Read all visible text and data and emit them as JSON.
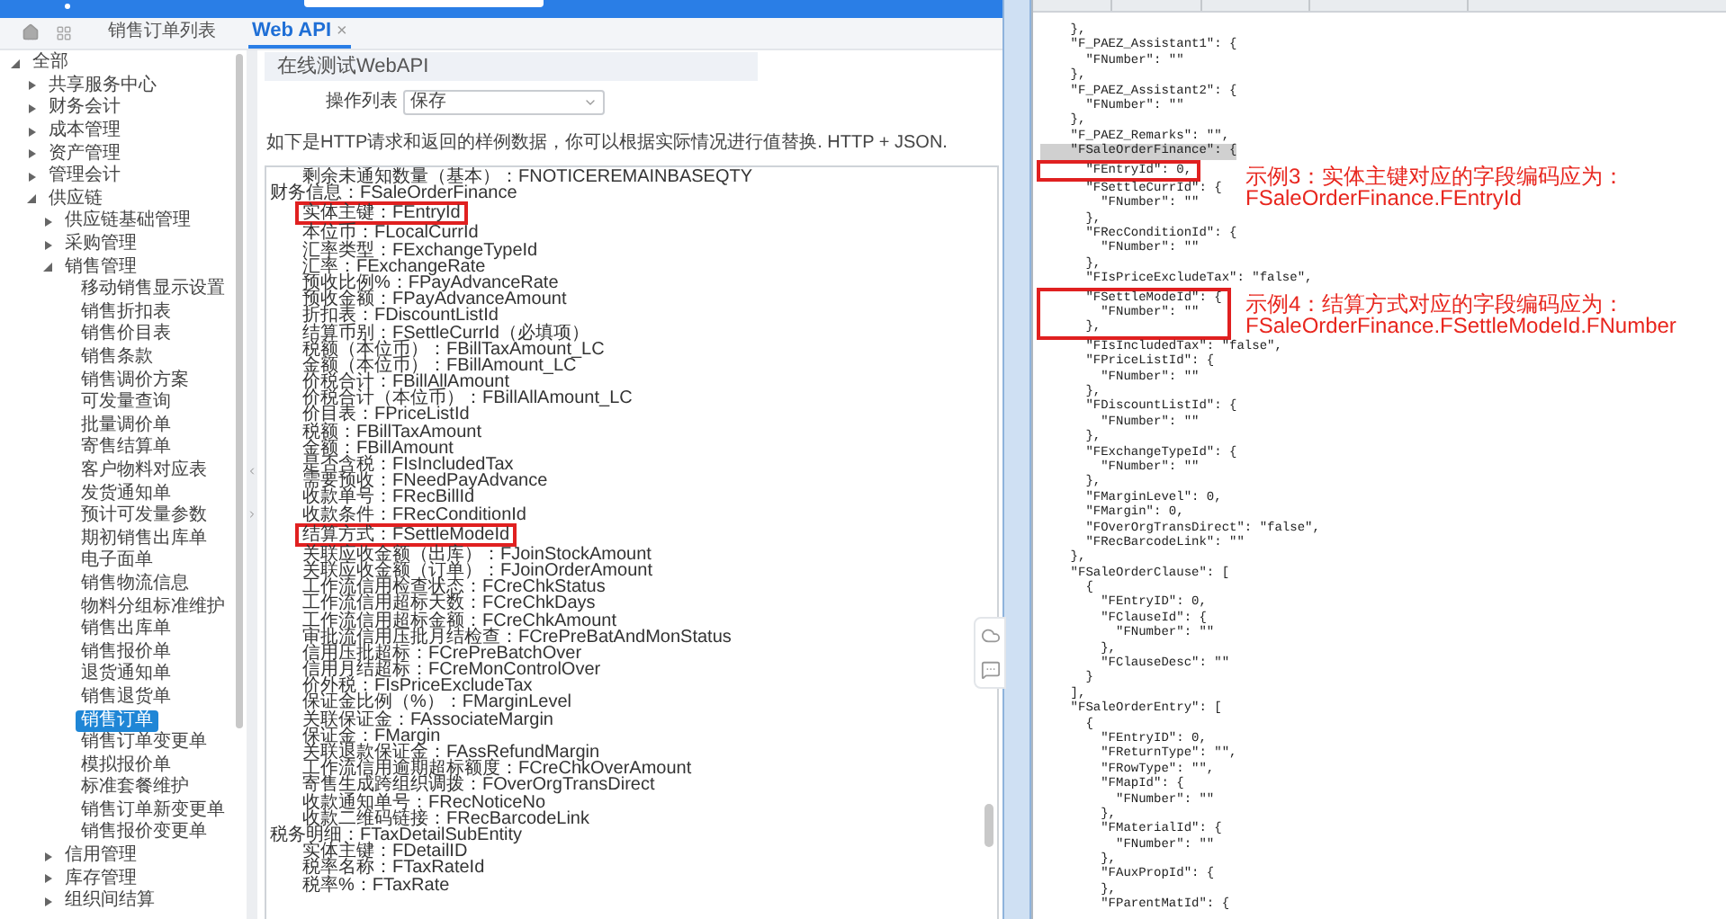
{
  "tabs": [
    {
      "label": "销售订单列表",
      "selected": false
    },
    {
      "label": "Web API",
      "selected": true,
      "close_glyph": "×"
    }
  ],
  "tree": [
    {
      "label": "全部",
      "selected": false,
      "expanded": true,
      "children": [
        {
          "label": "共享服务中心",
          "selected": false,
          "expanded": false
        },
        {
          "label": "财务会计",
          "selected": false,
          "expanded": false
        },
        {
          "label": "成本管理",
          "selected": false,
          "expanded": false
        },
        {
          "label": "资产管理",
          "selected": false,
          "expanded": false
        },
        {
          "label": "管理会计",
          "selected": false,
          "expanded": false
        },
        {
          "label": "供应链",
          "selected": false,
          "expanded": true,
          "children": [
            {
              "label": "供应链基础管理",
              "selected": false,
              "expanded": false
            },
            {
              "label": "采购管理",
              "selected": false,
              "expanded": false
            },
            {
              "label": "销售管理",
              "selected": false,
              "expanded": true,
              "children": [
                {
                  "label": "移动销售显示设置",
                  "selected": false
                },
                {
                  "label": "销售折扣表",
                  "selected": false
                },
                {
                  "label": "销售价目表",
                  "selected": false
                },
                {
                  "label": "销售条款",
                  "selected": false
                },
                {
                  "label": "销售调价方案",
                  "selected": false
                },
                {
                  "label": "可发量查询",
                  "selected": false
                },
                {
                  "label": "批量调价单",
                  "selected": false
                },
                {
                  "label": "寄售结算单",
                  "selected": false
                },
                {
                  "label": "客户物料对应表",
                  "selected": false
                },
                {
                  "label": "发货通知单",
                  "selected": false
                },
                {
                  "label": "预计可发量参数",
                  "selected": false
                },
                {
                  "label": "期初销售出库单",
                  "selected": false
                },
                {
                  "label": "电子面单",
                  "selected": false
                },
                {
                  "label": "销售物流信息",
                  "selected": false
                },
                {
                  "label": "物料分组标准维护",
                  "selected": false
                },
                {
                  "label": "销售出库单",
                  "selected": false
                },
                {
                  "label": "销售报价单",
                  "selected": false
                },
                {
                  "label": "退货通知单",
                  "selected": false
                },
                {
                  "label": "销售退货单",
                  "selected": false
                },
                {
                  "label": "销售订单",
                  "selected": true
                },
                {
                  "label": "销售订单变更单",
                  "selected": false
                },
                {
                  "label": "模拟报价单",
                  "selected": false
                },
                {
                  "label": "标准套餐维护",
                  "selected": false
                },
                {
                  "label": "销售订单新变更单",
                  "selected": false
                },
                {
                  "label": "销售报价变更单",
                  "selected": false
                }
              ]
            },
            {
              "label": "信用管理",
              "selected": false,
              "expanded": false
            },
            {
              "label": "库存管理",
              "selected": false,
              "expanded": false
            },
            {
              "label": "组织间结算",
              "selected": false,
              "expanded": false
            }
          ]
        }
      ]
    }
  ],
  "panel": {
    "title": "在线测试WebAPI",
    "operation_label": "操作列表",
    "operation_value": "保存",
    "description": "如下是HTTP请求和返回的样例数据，你可以根据实际情况进行值替换. HTTP + JSON."
  },
  "field_list": [
    {
      "kind": "field",
      "text": "剩余未通知数量（基本）：FNOTICEREMAINBASEQTY",
      "boxed": false
    },
    {
      "kind": "section",
      "text": "财务信息：FSaleOrderFinance",
      "boxed": false,
      "children": [
        {
          "kind": "field",
          "text": "实体主键：FEntryId",
          "boxed": true
        },
        {
          "kind": "field",
          "text": "本位币：FLocalCurrId",
          "boxed": false
        },
        {
          "kind": "field",
          "text": "汇率类型：FExchangeTypeId",
          "boxed": false
        },
        {
          "kind": "field",
          "text": "汇率：FExchangeRate",
          "boxed": false
        },
        {
          "kind": "field",
          "text": "预收比例%：FPayAdvanceRate",
          "boxed": false
        },
        {
          "kind": "field",
          "text": "预收金额：FPayAdvanceAmount",
          "boxed": false
        },
        {
          "kind": "field",
          "text": "折扣表：FDiscountListId",
          "boxed": false
        },
        {
          "kind": "field",
          "text": "结算币别：FSettleCurrId（必填项）",
          "boxed": false
        },
        {
          "kind": "field",
          "text": "税额（本位币）：FBillTaxAmount_LC",
          "boxed": false
        },
        {
          "kind": "field",
          "text": "金额（本位币）：FBillAmount_LC",
          "boxed": false
        },
        {
          "kind": "field",
          "text": "价税合计：FBillAllAmount",
          "boxed": false
        },
        {
          "kind": "field",
          "text": "价税合计（本位币）：FBillAllAmount_LC",
          "boxed": false
        },
        {
          "kind": "field",
          "text": "价目表：FPriceListId",
          "boxed": false
        },
        {
          "kind": "field",
          "text": "税额：FBillTaxAmount",
          "boxed": false
        },
        {
          "kind": "field",
          "text": "金额：FBillAmount",
          "boxed": false
        },
        {
          "kind": "field",
          "text": "是否含税：FIsIncludedTax",
          "boxed": false
        },
        {
          "kind": "field",
          "text": "需要预收：FNeedPayAdvance",
          "boxed": false
        },
        {
          "kind": "field",
          "text": "收款单号：FRecBillId",
          "boxed": false
        },
        {
          "kind": "field",
          "text": "收款条件：FRecConditionId",
          "boxed": false
        },
        {
          "kind": "field",
          "text": "结算方式：FSettleModeId",
          "boxed": true
        },
        {
          "kind": "field",
          "text": "关联应收金额（出库）：FJoinStockAmount",
          "boxed": false
        },
        {
          "kind": "field",
          "text": "关联应收金额（订单）：FJoinOrderAmount",
          "boxed": false
        },
        {
          "kind": "field",
          "text": "工作流信用检查状态：FCreChkStatus",
          "boxed": false
        },
        {
          "kind": "field",
          "text": "工作流信用超标天数：FCreChkDays",
          "boxed": false
        },
        {
          "kind": "field",
          "text": "工作流信用超标金额：FCreChkAmount",
          "boxed": false
        },
        {
          "kind": "field",
          "text": "审批流信用压批月结检查：FCrePreBatAndMonStatus",
          "boxed": false
        },
        {
          "kind": "field",
          "text": "信用压批超标：FCrePreBatchOver",
          "boxed": false
        },
        {
          "kind": "field",
          "text": "信用月结超标：FCreMonControlOver",
          "boxed": false
        },
        {
          "kind": "field",
          "text": "价外税：FIsPriceExcludeTax",
          "boxed": false
        },
        {
          "kind": "field",
          "text": "保证金比例（%）：FMarginLevel",
          "boxed": false
        },
        {
          "kind": "field",
          "text": "关联保证金：FAssociateMargin",
          "boxed": false
        },
        {
          "kind": "field",
          "text": "保证金：FMargin",
          "boxed": false
        },
        {
          "kind": "field",
          "text": "关联退款保证金：FAssRefundMargin",
          "boxed": false
        },
        {
          "kind": "field",
          "text": "工作流信用逾期超标额度：FCreChkOverAmount",
          "boxed": false
        },
        {
          "kind": "field",
          "text": "寄售生成跨组织调拨：FOverOrgTransDirect",
          "boxed": false
        },
        {
          "kind": "field",
          "text": "收款通知单号：FRecNoticeNo",
          "boxed": false
        },
        {
          "kind": "field",
          "text": "收款二维码链接：FRecBarcodeLink",
          "boxed": false
        }
      ]
    },
    {
      "kind": "section",
      "text": "税务明细：FTaxDetailSubEntity",
      "boxed": false,
      "children": [
        {
          "kind": "field",
          "text": "实体主键：FDetailID",
          "boxed": false
        },
        {
          "kind": "field",
          "text": "税率名称：FTaxRateId",
          "boxed": false
        },
        {
          "kind": "field",
          "text": "税率%：FTaxRate",
          "boxed": false
        }
      ]
    }
  ],
  "json_lines": [
    {
      "text": "    },",
      "boxed": false,
      "highlighted": false
    },
    {
      "text": "    \"F_PAEZ_Assistant1\": {",
      "boxed": false,
      "highlighted": false
    },
    {
      "text": "      \"FNumber\": \"\"",
      "boxed": false,
      "highlighted": false
    },
    {
      "text": "    },",
      "boxed": false,
      "highlighted": false
    },
    {
      "text": "    \"F_PAEZ_Assistant2\": {",
      "boxed": false,
      "highlighted": false
    },
    {
      "text": "      \"FNumber\": \"\"",
      "boxed": false,
      "highlighted": false
    },
    {
      "text": "    },",
      "boxed": false,
      "highlighted": false
    },
    {
      "text": "    \"F_PAEZ_Remarks\": \"\",",
      "boxed": false,
      "highlighted": false
    },
    {
      "text": "    \"FSaleOrderFinance\": {",
      "boxed": false,
      "highlighted": true
    },
    {
      "text": "      \"FEntryId\": 0,",
      "boxed": true,
      "highlighted": false,
      "note": [
        "示例3：实体主键对应的字段编码应为：",
        "FSaleOrderFinance.FEntryId"
      ]
    },
    {
      "text": "      \"FSettleCurrId\": {",
      "boxed": false,
      "highlighted": false
    },
    {
      "text": "        \"FNumber\": \"\"",
      "boxed": false,
      "highlighted": false
    },
    {
      "text": "      },",
      "boxed": false,
      "highlighted": false
    },
    {
      "text": "      \"FRecConditionId\": {",
      "boxed": false,
      "highlighted": false
    },
    {
      "text": "        \"FNumber\": \"\"",
      "boxed": false,
      "highlighted": false
    },
    {
      "text": "      },",
      "boxed": false,
      "highlighted": false
    },
    {
      "text": "      \"FIsPriceExcludeTax\": \"false\",",
      "boxed": false,
      "highlighted": false
    },
    {
      "text": "      \"FSettleModeId\": {",
      "boxed": true,
      "highlighted": false,
      "note": [
        "示例4：结算方式对应的字段编码应为：",
        "FSaleOrderFinance.FSettleModeId.FNumber"
      ]
    },
    {
      "text": "        \"FNumber\": \"\"",
      "boxed": true,
      "highlighted": false
    },
    {
      "text": "      },",
      "boxed": true,
      "highlighted": false
    },
    {
      "text": "      \"FIsIncludedTax\": \"false\",",
      "boxed": false,
      "highlighted": false
    },
    {
      "text": "      \"FPriceListId\": {",
      "boxed": false,
      "highlighted": false
    },
    {
      "text": "        \"FNumber\": \"\"",
      "boxed": false,
      "highlighted": false
    },
    {
      "text": "      },",
      "boxed": false,
      "highlighted": false
    },
    {
      "text": "      \"FDiscountListId\": {",
      "boxed": false,
      "highlighted": false
    },
    {
      "text": "        \"FNumber\": \"\"",
      "boxed": false,
      "highlighted": false
    },
    {
      "text": "      },",
      "boxed": false,
      "highlighted": false
    },
    {
      "text": "      \"FExchangeTypeId\": {",
      "boxed": false,
      "highlighted": false
    },
    {
      "text": "        \"FNumber\": \"\"",
      "boxed": false,
      "highlighted": false
    },
    {
      "text": "      },",
      "boxed": false,
      "highlighted": false
    },
    {
      "text": "      \"FMarginLevel\": 0,",
      "boxed": false,
      "highlighted": false
    },
    {
      "text": "      \"FMargin\": 0,",
      "boxed": false,
      "highlighted": false
    },
    {
      "text": "      \"FOverOrgTransDirect\": \"false\",",
      "boxed": false,
      "highlighted": false
    },
    {
      "text": "      \"FRecBarcodeLink\": \"\"",
      "boxed": false,
      "highlighted": false
    },
    {
      "text": "    },",
      "boxed": false,
      "highlighted": false
    },
    {
      "text": "    \"FSaleOrderClause\": [",
      "boxed": false,
      "highlighted": false
    },
    {
      "text": "      {",
      "boxed": false,
      "highlighted": false
    },
    {
      "text": "        \"FEntryID\": 0,",
      "boxed": false,
      "highlighted": false
    },
    {
      "text": "        \"FClauseId\": {",
      "boxed": false,
      "highlighted": false
    },
    {
      "text": "          \"FNumber\": \"\"",
      "boxed": false,
      "highlighted": false
    },
    {
      "text": "        },",
      "boxed": false,
      "highlighted": false
    },
    {
      "text": "        \"FClauseDesc\": \"\"",
      "boxed": false,
      "highlighted": false
    },
    {
      "text": "      }",
      "boxed": false,
      "highlighted": false
    },
    {
      "text": "    ],",
      "boxed": false,
      "highlighted": false
    },
    {
      "text": "    \"FSaleOrderEntry\": [",
      "boxed": false,
      "highlighted": false
    },
    {
      "text": "      {",
      "boxed": false,
      "highlighted": false
    },
    {
      "text": "        \"FEntryID\": 0,",
      "boxed": false,
      "highlighted": false
    },
    {
      "text": "        \"FReturnType\": \"\",",
      "boxed": false,
      "highlighted": false
    },
    {
      "text": "        \"FRowType\": \"\",",
      "boxed": false,
      "highlighted": false
    },
    {
      "text": "        \"FMapId\": {",
      "boxed": false,
      "highlighted": false
    },
    {
      "text": "          \"FNumber\": \"\"",
      "boxed": false,
      "highlighted": false
    },
    {
      "text": "        },",
      "boxed": false,
      "highlighted": false
    },
    {
      "text": "        \"FMaterialId\": {",
      "boxed": false,
      "highlighted": false
    },
    {
      "text": "          \"FNumber\": \"\"",
      "boxed": false,
      "highlighted": false
    },
    {
      "text": "        },",
      "boxed": false,
      "highlighted": false
    },
    {
      "text": "        \"FAuxPropId\": {",
      "boxed": false,
      "highlighted": false
    },
    {
      "text": "        },",
      "boxed": false,
      "highlighted": false
    },
    {
      "text": "        \"FParentMatId\": {",
      "boxed": false,
      "highlighted": false
    }
  ]
}
